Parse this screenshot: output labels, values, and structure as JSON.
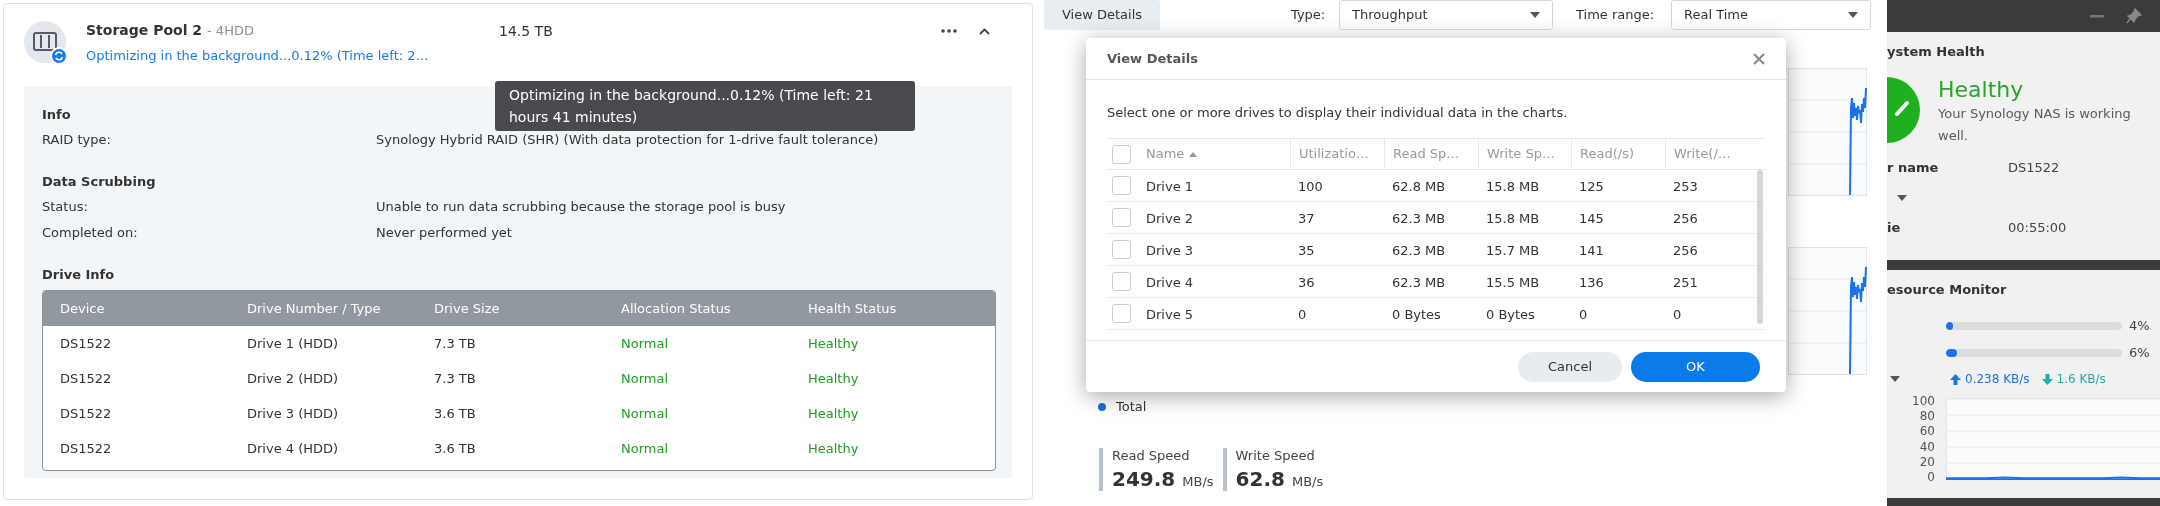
{
  "storage_pool": {
    "title": "Storage Pool 2",
    "subtitle": "- 4HDD",
    "size": "14.5 TB",
    "status": "Optimizing in the background...0.12% (Time left: 2…",
    "tooltip": "Optimizing in the background...0.12% (Time left: 21 hours 41 minutes)",
    "sections": [
      {
        "heading": "Info",
        "rows": [
          {
            "label": "RAID type:",
            "value": "Synology Hybrid RAID (SHR) (With data protection for 1-drive fault tolerance)"
          }
        ]
      },
      {
        "heading": "Data Scrubbing",
        "rows": [
          {
            "label": "Status:",
            "value": "Unable to run data scrubbing because the storage pool is busy"
          },
          {
            "label": "Completed on:",
            "value": "Never performed yet"
          }
        ]
      }
    ],
    "drive_info": {
      "heading": "Drive Info",
      "columns": [
        "Device",
        "Drive Number / Type",
        "Drive Size",
        "Allocation Status",
        "Health Status"
      ],
      "rows": [
        [
          "DS1522",
          "Drive 1 (HDD)",
          "7.3 TB",
          "Normal",
          "Healthy"
        ],
        [
          "DS1522",
          "Drive 2 (HDD)",
          "7.3 TB",
          "Normal",
          "Healthy"
        ],
        [
          "DS1522",
          "Drive 3 (HDD)",
          "3.6 TB",
          "Normal",
          "Healthy"
        ],
        [
          "DS1522",
          "Drive 4 (HDD)",
          "3.6 TB",
          "Normal",
          "Healthy"
        ]
      ]
    }
  },
  "toolbar": {
    "view_details": "View Details",
    "type_label": "Type:",
    "type_value": "Throughput",
    "time_range_label": "Time range:",
    "time_range_value": "Real Time"
  },
  "legend": "Total",
  "speeds": [
    {
      "label": "Read Speed",
      "value": "249.8",
      "unit": "MB/s"
    },
    {
      "label": "Write Speed",
      "value": "62.8",
      "unit": "MB/s"
    }
  ],
  "dialog": {
    "title": "View Details",
    "description": "Select one or more drives to display their individual data in the charts.",
    "select_all_checked": false,
    "columns": [
      "Name",
      "Utilizatio…",
      "Read Sp…",
      "Write Sp…",
      "Read(/s)",
      "Write(/…"
    ],
    "rows": [
      {
        "checked": false,
        "cells": [
          "Drive 1",
          "100",
          "62.8 MB",
          "15.8 MB",
          "125",
          "253"
        ]
      },
      {
        "checked": false,
        "cells": [
          "Drive 2",
          "37",
          "62.3 MB",
          "15.8 MB",
          "145",
          "256"
        ]
      },
      {
        "checked": false,
        "cells": [
          "Drive 3",
          "35",
          "62.3 MB",
          "15.7 MB",
          "141",
          "256"
        ]
      },
      {
        "checked": false,
        "cells": [
          "Drive 4",
          "36",
          "62.3 MB",
          "15.5 MB",
          "136",
          "251"
        ]
      },
      {
        "checked": false,
        "cells": [
          "Drive 5",
          "0",
          "0 Bytes",
          "0 Bytes",
          "0",
          "0"
        ]
      }
    ],
    "buttons": [
      {
        "label": "Cancel",
        "kind": "secondary"
      },
      {
        "label": "OK",
        "kind": "primary"
      }
    ]
  },
  "system_health": {
    "title": "ystem Health",
    "status": "Healthy",
    "message": "Your Synology NAS is working well.",
    "rows": [
      {
        "label": "r name",
        "value": "DS1522"
      },
      {
        "label": "ie",
        "value": "00:55:00"
      }
    ]
  },
  "resource_monitor": {
    "title": "esource Monitor",
    "meters": [
      {
        "level": 0.04,
        "reading": "4%"
      },
      {
        "level": 0.06,
        "reading": "6%"
      }
    ],
    "upload": "0.238 KB/s",
    "download": "1.6 KB/s",
    "chart_data": {
      "type": "area",
      "grid": true,
      "ylim": [
        0,
        100
      ],
      "yticks": [
        0,
        20,
        40,
        60,
        80,
        100
      ],
      "series": [
        {
          "color": "#1a73e8",
          "values": [
            1,
            1,
            1,
            2,
            1,
            1,
            1,
            1,
            1,
            2,
            1,
            1
          ]
        }
      ]
    }
  }
}
